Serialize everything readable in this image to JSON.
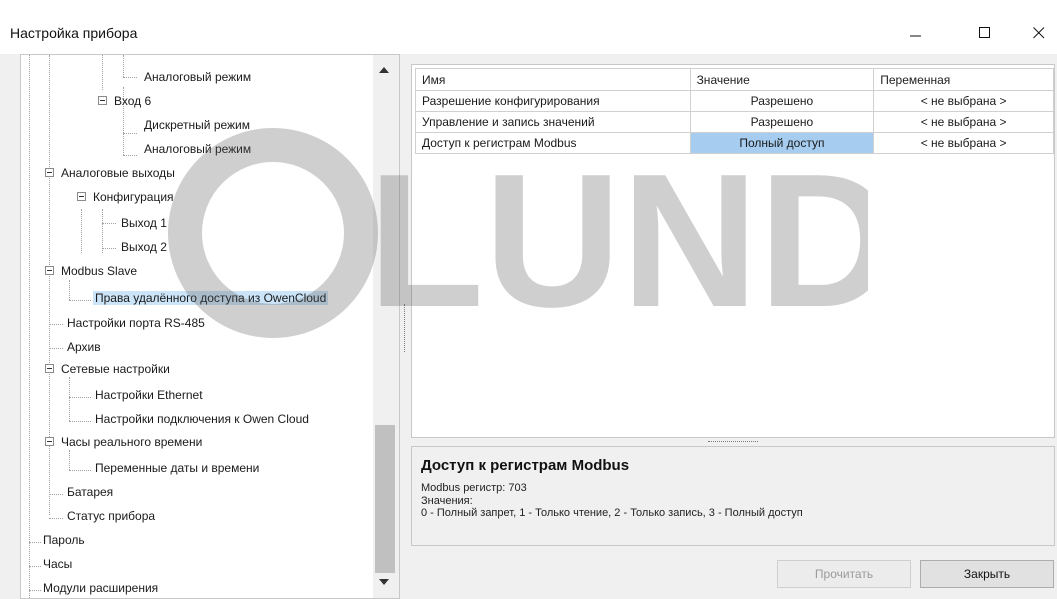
{
  "window": {
    "title": "Настройка прибора",
    "controls": {
      "minimize": "minimize-icon",
      "maximize": "maximize-icon",
      "close": "close-icon"
    }
  },
  "tree": {
    "items": [
      {
        "label": "Аналоговый режим"
      },
      {
        "label": "Вход 6"
      },
      {
        "label": "Дискретный режим"
      },
      {
        "label": "Аналоговый режим"
      },
      {
        "label": "Аналоговые выходы"
      },
      {
        "label": "Конфигурация"
      },
      {
        "label": "Выход 1"
      },
      {
        "label": "Выход 2"
      },
      {
        "label": "Modbus Slave"
      },
      {
        "label": "Права удалённого доступа из OwenCloud"
      },
      {
        "label": "Настройки порта RS-485"
      },
      {
        "label": "Архив"
      },
      {
        "label": "Сетевые настройки"
      },
      {
        "label": "Настройки Ethernet"
      },
      {
        "label": "Настройки подключения к Owen Cloud"
      },
      {
        "label": "Часы реального времени"
      },
      {
        "label": "Переменные даты и времени"
      },
      {
        "label": "Батарея"
      },
      {
        "label": "Статус прибора"
      },
      {
        "label": "Пароль"
      },
      {
        "label": "Часы"
      },
      {
        "label": "Модули расширения"
      }
    ]
  },
  "grid": {
    "columns": [
      "Имя",
      "Значение",
      "Переменная"
    ],
    "rows": [
      {
        "name": "Разрешение конфигурирования",
        "value": "Разрешено",
        "variable": "< не выбрана >"
      },
      {
        "name": "Управление и запись значений",
        "value": "Разрешено",
        "variable": "< не выбрана >"
      },
      {
        "name": "Доступ к регистрам Modbus",
        "value": "Полный доступ",
        "variable": "< не выбрана >"
      }
    ]
  },
  "description": {
    "title": "Доступ к регистрам Modbus",
    "line1": "Modbus регистр: 703",
    "line2": "Значения:",
    "line3": "0 - Полный запрет, 1 - Только чтение, 2 - Только запись, 3 - Полный доступ"
  },
  "buttons": {
    "read": "Прочитать",
    "close": "Закрыть"
  },
  "watermark": "LUNDA",
  "colors": {
    "selection": "#cce4f7",
    "value_highlight": "#a6cdf0",
    "background": "#f0f0f0"
  }
}
